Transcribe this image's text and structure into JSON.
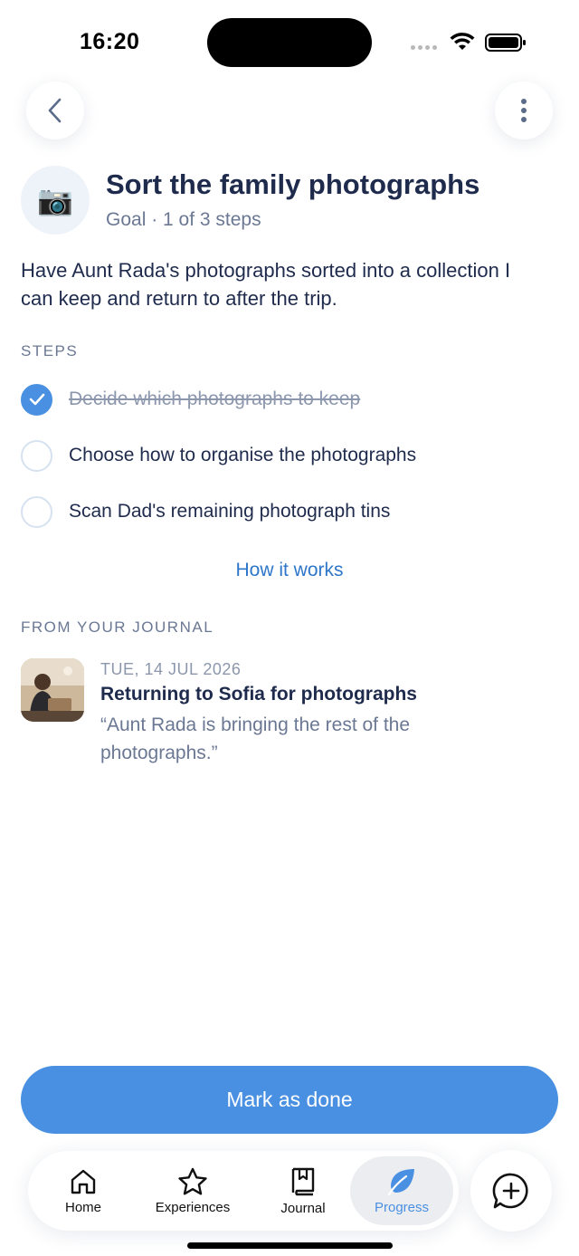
{
  "status_bar": {
    "time": "16:20"
  },
  "header": {
    "back_icon": "chevron-left-icon",
    "more_icon": "more-vertical-icon"
  },
  "goal": {
    "emoji": "📷",
    "title": "Sort the family photographs",
    "subtitle": "Goal · 1 of 3 steps",
    "description": "Have Aunt Rada's photographs sorted into a collection I can keep and return to after the trip."
  },
  "steps_section": {
    "label": "STEPS",
    "items": [
      {
        "label": "Decide which photographs to keep",
        "done": true
      },
      {
        "label": "Choose how to organise the photographs",
        "done": false
      },
      {
        "label": "Scan Dad's remaining photograph tins",
        "done": false
      }
    ],
    "how_it_works": "How it works"
  },
  "journal_section": {
    "label": "FROM YOUR JOURNAL",
    "entry": {
      "date": "TUE, 14 JUL 2026",
      "title": "Returning to Sofia for photographs",
      "quote": "“Aunt Rada is bringing the rest of the photographs.”"
    }
  },
  "primary_action": {
    "label": "Mark as done"
  },
  "tab_bar": {
    "tabs": [
      {
        "label": "Home",
        "icon": "home-icon"
      },
      {
        "label": "Experiences",
        "icon": "star-icon"
      },
      {
        "label": "Journal",
        "icon": "journal-icon"
      },
      {
        "label": "Progress",
        "icon": "leaf-icon",
        "active": true
      }
    ],
    "compose_icon": "plus-chat-icon"
  },
  "colors": {
    "accent": "#4a90e2",
    "text_primary": "#1f2b4d",
    "text_secondary": "#6b7894",
    "link": "#2d76c9"
  }
}
